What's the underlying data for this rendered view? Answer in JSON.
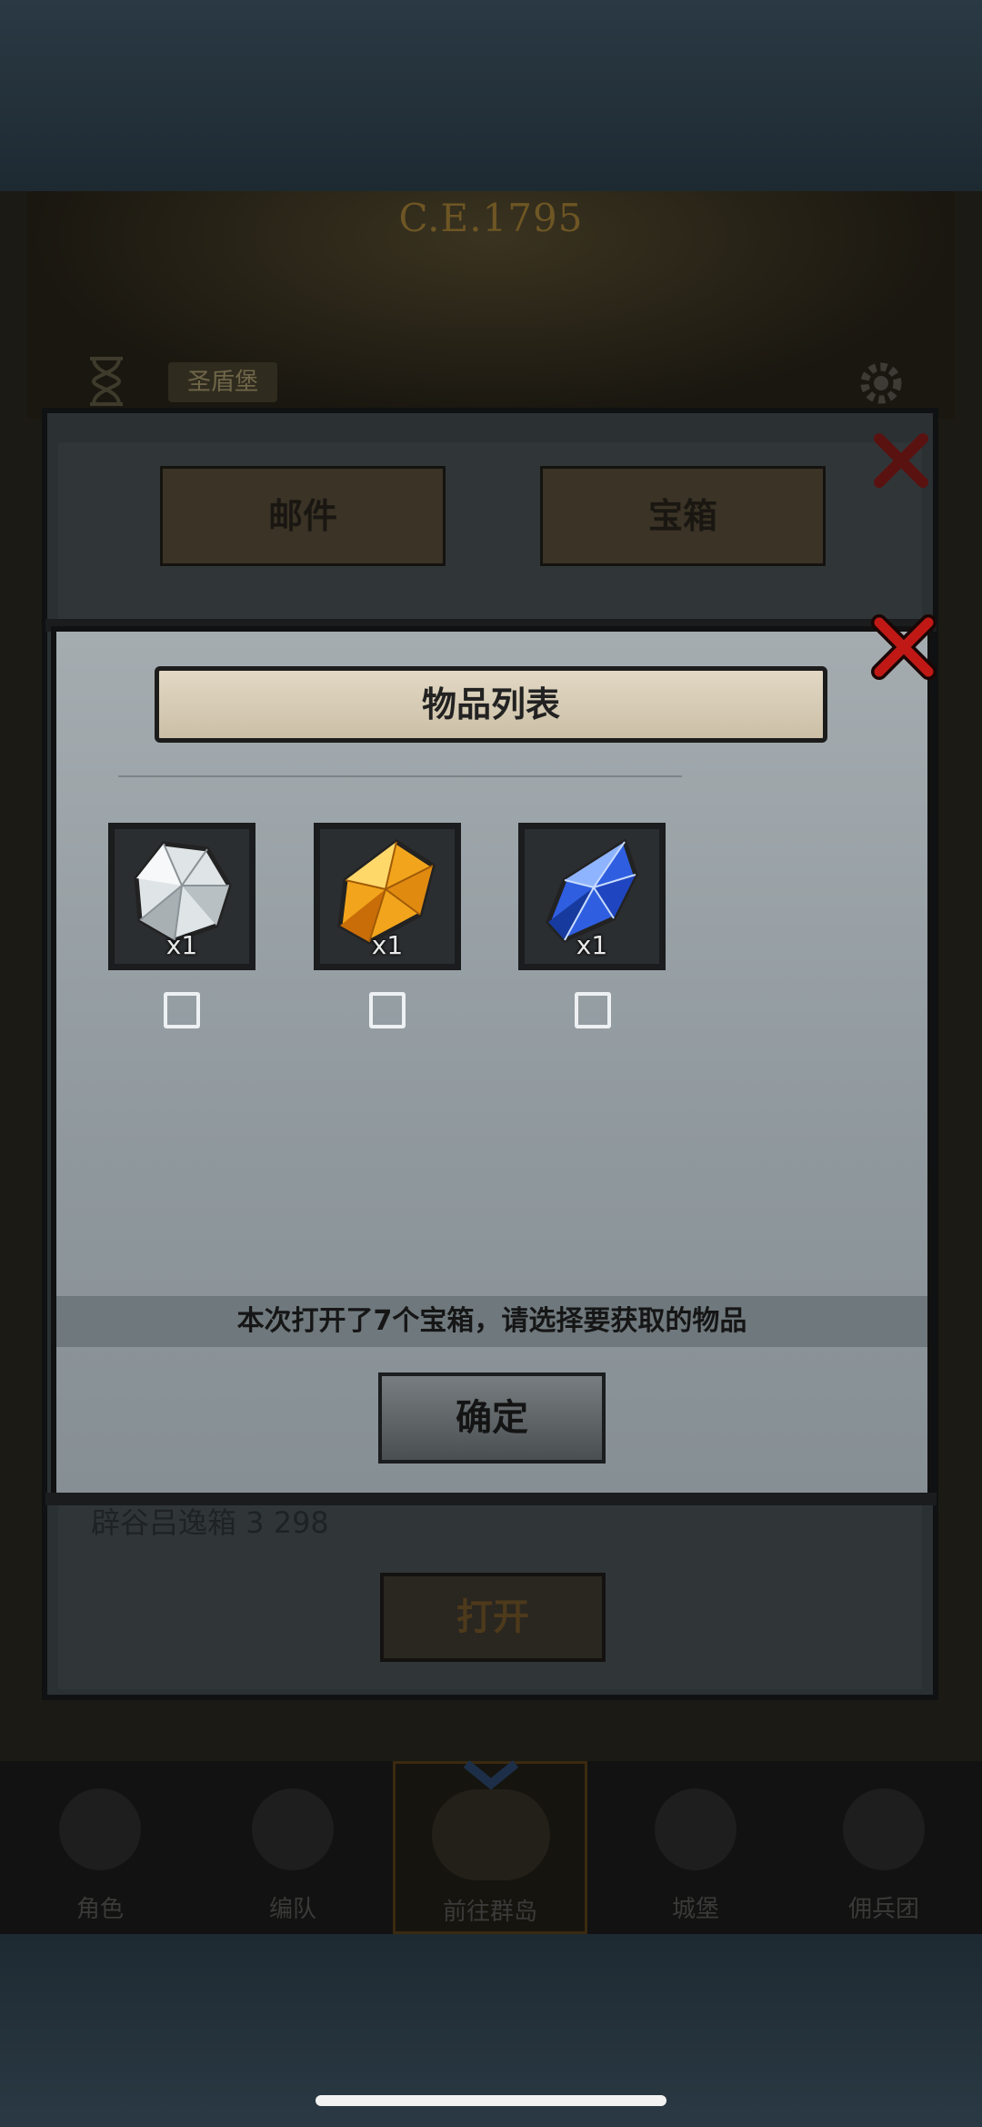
{
  "background": {
    "year_text": "C.E.1795",
    "location_label": "圣盾堡",
    "icons": [
      "hourglass-icon",
      "gear-icon"
    ]
  },
  "back_panel": {
    "tabs": [
      {
        "label": "邮件",
        "active": false
      },
      {
        "label": "宝箱",
        "active": true
      }
    ],
    "row_text": "辟谷吕逸箱 3     298",
    "open_label": "打开"
  },
  "dialog": {
    "title": "物品列表",
    "items": [
      {
        "name": "white crystal",
        "qty": "x1",
        "checked": false,
        "color": "#e6eaec"
      },
      {
        "name": "amber crystal",
        "qty": "x1",
        "checked": false,
        "color": "#f2a51c"
      },
      {
        "name": "blue crystal",
        "qty": "x1",
        "checked": false,
        "color": "#2f5fe0"
      }
    ],
    "info": "本次打开了7个宝箱，请选择要获取的物品",
    "confirm_label": "确定"
  },
  "bottom_nav": [
    {
      "label": "角色",
      "icon": "character-icon",
      "active": false
    },
    {
      "label": "编队",
      "icon": "formation-icon",
      "active": false
    },
    {
      "label": "前往群岛",
      "icon": "islands-icon",
      "active": true
    },
    {
      "label": "城堡",
      "icon": "castle-icon",
      "active": false
    },
    {
      "label": "佣兵团",
      "icon": "mercenary-icon",
      "active": false
    }
  ]
}
